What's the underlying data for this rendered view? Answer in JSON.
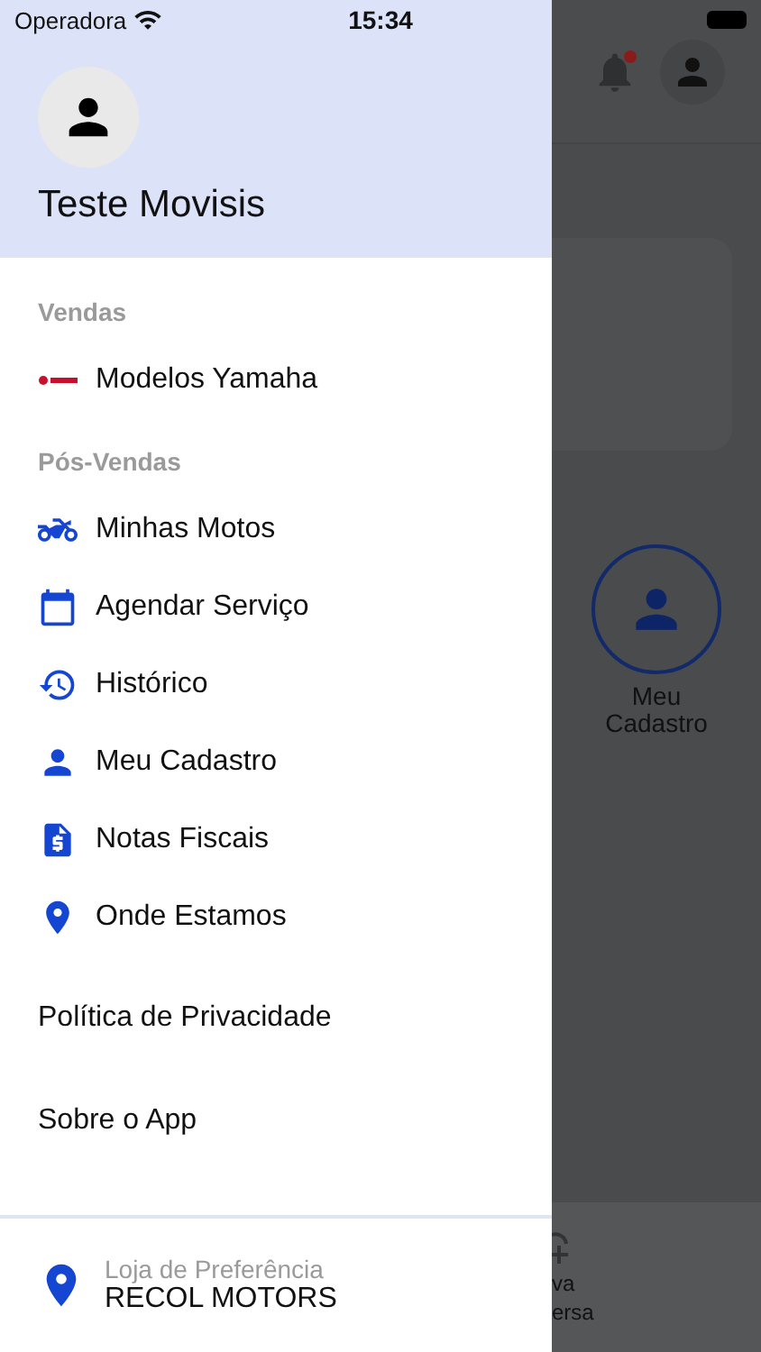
{
  "status_bar": {
    "carrier": "Operadora",
    "time": "15:34"
  },
  "drawer": {
    "user_name": "Teste Movisis",
    "sections": [
      {
        "title": "Vendas",
        "items": [
          {
            "label": "Modelos Yamaha",
            "kind": "brand"
          }
        ]
      },
      {
        "title": "Pós-Vendas",
        "items": [
          {
            "label": "Minhas Motos",
            "kind": "motorcycle"
          },
          {
            "label": "Agendar Serviço",
            "kind": "calendar"
          },
          {
            "label": "Histórico",
            "kind": "history"
          },
          {
            "label": "Meu Cadastro",
            "kind": "person"
          },
          {
            "label": "Notas Fiscais",
            "kind": "invoice"
          },
          {
            "label": "Onde Estamos",
            "kind": "pin"
          }
        ]
      }
    ],
    "links": [
      "Política de Privacidade",
      "Sobre o App"
    ],
    "footer": {
      "label": "Loja de Preferência",
      "store": "RECOL MOTORS"
    }
  },
  "background": {
    "shortcut": {
      "label": "Meu Cadastro"
    },
    "tab_label_lines": [
      "va",
      "ersa"
    ]
  }
}
